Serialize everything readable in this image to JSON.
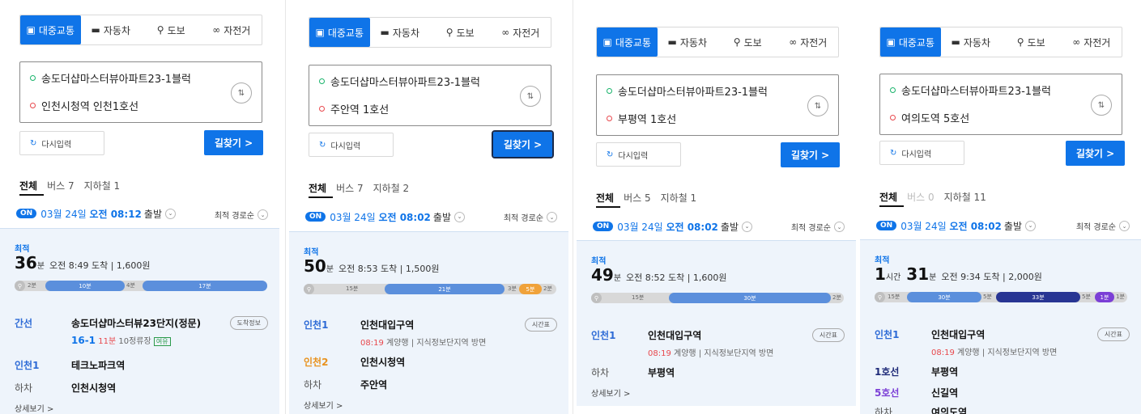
{
  "panels": [
    {
      "modes": [
        "대중교통",
        "자동차",
        "도보",
        "자전거"
      ],
      "start": "송도더샵마스터뷰아파트23-1블럭",
      "end": "인천시청역 인천1호선",
      "reset": "다시입력",
      "search": "길찾기 >",
      "tabs": [
        "전체",
        "버스 7",
        "지하철 1"
      ],
      "on": "ON",
      "dep_date": "03월 24일",
      "dep_time": "오전 08:12",
      "dep_suffix": "출발",
      "sort": "최적 경로순",
      "best": "최적",
      "dur_num": "36",
      "dur_unit": "분",
      "dur_meta": "오전 8:49 도착 | 1,600원",
      "bar": {
        "a": "2분",
        "b": "10분",
        "c": "4분",
        "d": "17분"
      },
      "steps": [
        {
          "line": "간선",
          "stop": "송도더샵마스터뷰23단지(정문)"
        },
        {
          "line": "인천1",
          "stop": "테크노파크역"
        },
        {
          "line": "하차",
          "stop": "인천시청역"
        }
      ],
      "sub": {
        "busno": "16-1",
        "min": "11분",
        "stops": "10정류장",
        "tag": "여유"
      },
      "pill": "도착정보",
      "detail": "상세보기 >"
    },
    {
      "modes": [
        "대중교통",
        "자동차",
        "도보",
        "자전거"
      ],
      "start": "송도더샵마스터뷰아파트23-1블럭",
      "end": "주안역 1호선",
      "reset": "다시입력",
      "search": "길찾기 >",
      "tabs": [
        "전체",
        "버스 7",
        "지하철 2"
      ],
      "on": "ON",
      "dep_date": "03월 24일",
      "dep_time": "오전 08:02",
      "dep_suffix": "출발",
      "sort": "최적 경로순",
      "best": "최적",
      "dur_num": "50",
      "dur_unit": "분",
      "dur_meta": "오전 8:53 도착 | 1,500원",
      "bar": {
        "a": "15분",
        "b": "21분",
        "c": "3분",
        "d": "5분",
        "e": "2분"
      },
      "steps": [
        {
          "line": "인천1",
          "stop": "인천대입구역"
        },
        {
          "line": "인천2",
          "stop": "인천시청역"
        },
        {
          "line": "하차",
          "stop": "주안역"
        }
      ],
      "sub": {
        "time": "08:19",
        "dir": "계양행 | 지식정보단지역 방면"
      },
      "pill": "시간표",
      "detail": "상세보기 >"
    },
    {
      "modes": [
        "대중교통",
        "자동차",
        "도보",
        "자전거"
      ],
      "start": "송도더샵마스터뷰아파트23-1블럭",
      "end": "부평역 1호선",
      "reset": "다시입력",
      "search": "길찾기 >",
      "tabs": [
        "전체",
        "버스 5",
        "지하철 1"
      ],
      "on": "ON",
      "dep_date": "03월 24일",
      "dep_time": "오전 08:02",
      "dep_suffix": "출발",
      "sort": "최적 경로순",
      "best": "최적",
      "dur_num": "49",
      "dur_unit": "분",
      "dur_meta": "오전 8:52 도착 | 1,600원",
      "bar": {
        "a": "15분",
        "b": "30분",
        "c": "2분"
      },
      "steps": [
        {
          "line": "인천1",
          "stop": "인천대입구역"
        },
        {
          "line": "하차",
          "stop": "부평역"
        }
      ],
      "sub": {
        "time": "08:19",
        "dir": "계양행 | 지식정보단지역 방면"
      },
      "pill": "시간표",
      "detail": "상세보기 >"
    },
    {
      "modes": [
        "대중교통",
        "자동차",
        "도보",
        "자전거"
      ],
      "start": "송도더샵마스터뷰아파트23-1블럭",
      "end": "여의도역 5호선",
      "reset": "다시입력",
      "search": "길찾기 >",
      "tabs": [
        "전체",
        "버스 0",
        "지하철 11"
      ],
      "on": "ON",
      "dep_date": "03월 24일",
      "dep_time": "오전 08:02",
      "dep_suffix": "출발",
      "sort": "최적 경로순",
      "best": "최적",
      "dur_h": "1",
      "dur_h_unit": "시간",
      "dur_num": "31",
      "dur_unit": "분",
      "dur_meta": "오전 9:34 도착 | 2,000원",
      "bar": {
        "a": "15분",
        "b": "30분",
        "c": "5분",
        "d": "33분",
        "e": "5분",
        "f": "1분",
        "g": "1분"
      },
      "steps": [
        {
          "line": "인천1",
          "stop": "인천대입구역"
        },
        {
          "line": "1호선",
          "stop": "부평역"
        },
        {
          "line": "5호선",
          "stop": "신길역"
        },
        {
          "line": "하차",
          "stop": "여의도역"
        }
      ],
      "sub": {
        "time": "08:19",
        "dir": "계양행 | 지식정보단지역 방면"
      },
      "pill": "시간표"
    }
  ]
}
